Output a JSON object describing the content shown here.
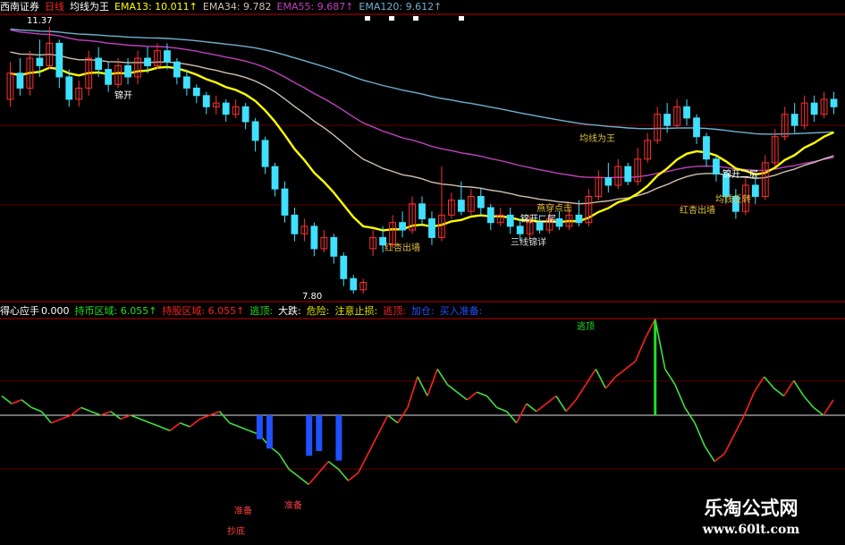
{
  "colors": {
    "background": "#000000",
    "separator": "#c00000",
    "up": "#ff3030",
    "down": "#40e0ff",
    "ema13": "#ffff00",
    "ema34": "#d0c0b0",
    "ema55": "#c040c0",
    "ema120": "#70b0d0",
    "osc_up": "#ff2020",
    "osc_down": "#40e040",
    "bar_blue": "#2050ff",
    "bar_green": "#20e020",
    "zero_line": "#e0e0e0"
  },
  "main_header": {
    "stock": "西南证券",
    "period": "日线",
    "indicator": "均线为王",
    "ema13": "EMA13: 10.011↑",
    "ema34": "EMA34: 9.782",
    "ema55": "EMA55: 9.687↑",
    "ema120": "EMA120: 9.612↑"
  },
  "main_annotations": {
    "high_price": "11.37",
    "low_price": "7.80",
    "labels": [
      "锦开",
      "红杏出墙",
      "三线锦详",
      "锦开二层",
      "锦开二层",
      "燕穿点击",
      "均线为王",
      "红杏出墙",
      "均线反转",
      "锦开二层"
    ]
  },
  "sub_header": {
    "name": "得心应手",
    "value": "0.000",
    "items": [
      {
        "text": "持币区域: 6.055↑",
        "color": "#20e020"
      },
      {
        "text": "持股区域: 6.055↑",
        "color": "#ff2020"
      },
      {
        "text": "逃顶:",
        "color": "#20e020"
      },
      {
        "text": "大跌:",
        "color": "#ffffff"
      },
      {
        "text": "危险:",
        "color": "#e0e000"
      },
      {
        "text": "注意止损:",
        "color": "#e0e000"
      },
      {
        "text": "逃顶:",
        "color": "#ff2020"
      },
      {
        "text": "加仓:",
        "color": "#2050ff"
      },
      {
        "text": "买入准备:",
        "color": "#2050ff"
      }
    ]
  },
  "sub_annotations": {
    "top_label": "逃顶",
    "bottom_labels": [
      "抄底",
      "准备",
      "准备"
    ]
  },
  "watermark": {
    "line1": "乐淘公式网",
    "line2": "www.60lt.com"
  },
  "chart_data": {
    "type": "line",
    "price_range": [
      7.8,
      11.37
    ],
    "candles": [
      [
        10.4,
        10.75,
        10.9,
        10.3
      ],
      [
        10.75,
        10.55,
        10.95,
        10.45
      ],
      [
        10.55,
        10.95,
        11.05,
        10.45
      ],
      [
        10.95,
        10.85,
        11.2,
        10.7
      ],
      [
        10.85,
        11.15,
        11.37,
        10.8
      ],
      [
        11.15,
        10.7,
        11.2,
        10.55
      ],
      [
        10.7,
        10.4,
        10.8,
        10.3
      ],
      [
        10.4,
        10.55,
        10.65,
        10.3
      ],
      [
        10.55,
        10.95,
        11.05,
        10.45
      ],
      [
        10.95,
        10.8,
        11.1,
        10.7
      ],
      [
        10.8,
        10.6,
        10.9,
        10.5
      ],
      [
        10.6,
        10.85,
        10.95,
        10.55
      ],
      [
        10.85,
        10.7,
        10.95,
        10.6
      ],
      [
        10.7,
        10.95,
        11.05,
        10.6
      ],
      [
        10.95,
        10.85,
        11.1,
        10.75
      ],
      [
        10.85,
        11.05,
        11.15,
        10.8
      ],
      [
        11.05,
        10.9,
        11.15,
        10.8
      ],
      [
        10.9,
        10.7,
        10.95,
        10.6
      ],
      [
        10.7,
        10.55,
        10.8,
        10.45
      ],
      [
        10.55,
        10.45,
        10.6,
        10.35
      ],
      [
        10.45,
        10.3,
        10.5,
        10.2
      ],
      [
        10.3,
        10.35,
        10.45,
        10.2
      ],
      [
        10.35,
        10.2,
        10.4,
        10.1
      ],
      [
        10.2,
        10.3,
        10.4,
        10.15
      ],
      [
        10.3,
        10.1,
        10.35,
        10.0
      ],
      [
        10.1,
        9.85,
        10.15,
        9.7
      ],
      [
        9.85,
        9.5,
        9.9,
        9.4
      ],
      [
        9.5,
        9.2,
        9.55,
        9.1
      ],
      [
        9.2,
        8.85,
        9.3,
        8.75
      ],
      [
        8.85,
        8.6,
        8.95,
        8.5
      ],
      [
        8.6,
        8.7,
        8.8,
        8.5
      ],
      [
        8.7,
        8.4,
        8.75,
        8.3
      ],
      [
        8.4,
        8.55,
        8.65,
        8.35
      ],
      [
        8.55,
        8.3,
        8.6,
        8.2
      ],
      [
        8.3,
        8.0,
        8.35,
        7.9
      ],
      [
        8.0,
        7.85,
        8.05,
        7.8
      ],
      [
        7.85,
        7.95,
        8.0,
        7.8
      ],
      [
        8.4,
        8.55,
        8.65,
        8.3
      ],
      [
        8.55,
        8.45,
        8.7,
        8.35
      ],
      [
        8.45,
        8.75,
        8.85,
        8.4
      ],
      [
        8.75,
        8.65,
        8.9,
        8.55
      ],
      [
        8.65,
        9.0,
        9.1,
        8.6
      ],
      [
        9.0,
        8.8,
        9.1,
        8.7
      ],
      [
        8.8,
        8.55,
        8.9,
        8.45
      ],
      [
        8.55,
        8.85,
        9.5,
        8.5
      ],
      [
        8.85,
        9.05,
        9.15,
        8.8
      ],
      [
        9.05,
        8.9,
        9.3,
        8.85
      ],
      [
        8.9,
        9.1,
        9.2,
        8.85
      ],
      [
        9.1,
        8.95,
        9.2,
        8.85
      ],
      [
        8.95,
        8.75,
        9.0,
        8.65
      ],
      [
        8.75,
        8.85,
        8.95,
        8.7
      ],
      [
        8.85,
        8.7,
        8.95,
        8.6
      ],
      [
        8.7,
        8.6,
        8.8,
        8.5
      ],
      [
        8.6,
        8.75,
        8.85,
        8.55
      ],
      [
        8.75,
        8.65,
        8.85,
        8.6
      ],
      [
        8.65,
        8.8,
        8.9,
        8.6
      ],
      [
        8.8,
        8.7,
        8.9,
        8.65
      ],
      [
        8.7,
        8.85,
        8.95,
        8.65
      ],
      [
        8.85,
        8.75,
        9.05,
        8.7
      ],
      [
        8.75,
        9.1,
        9.2,
        8.7
      ],
      [
        9.1,
        9.35,
        9.45,
        9.05
      ],
      [
        9.35,
        9.25,
        9.55,
        9.15
      ],
      [
        9.25,
        9.5,
        9.6,
        9.2
      ],
      [
        9.5,
        9.3,
        9.55,
        9.25
      ],
      [
        9.3,
        9.6,
        9.75,
        9.25
      ],
      [
        9.6,
        9.85,
        9.95,
        9.55
      ],
      [
        9.85,
        10.2,
        10.3,
        9.8
      ],
      [
        10.2,
        10.05,
        10.35,
        9.95
      ],
      [
        10.05,
        10.3,
        10.4,
        10.0
      ],
      [
        10.3,
        10.15,
        10.4,
        10.05
      ],
      [
        10.15,
        9.9,
        10.2,
        9.8
      ],
      [
        9.9,
        9.6,
        9.95,
        9.5
      ],
      [
        9.6,
        9.4,
        9.65,
        9.3
      ],
      [
        9.4,
        9.1,
        9.45,
        9.0
      ],
      [
        9.1,
        8.9,
        9.2,
        8.8
      ],
      [
        8.9,
        9.25,
        9.35,
        8.85
      ],
      [
        9.25,
        9.1,
        9.35,
        9.0
      ],
      [
        9.1,
        9.55,
        9.65,
        9.05
      ],
      [
        9.55,
        9.9,
        10.0,
        9.5
      ],
      [
        9.9,
        10.2,
        10.3,
        9.85
      ],
      [
        10.2,
        10.05,
        10.35,
        9.95
      ],
      [
        10.05,
        10.35,
        10.45,
        10.0
      ],
      [
        10.35,
        10.2,
        10.45,
        10.1
      ],
      [
        10.2,
        10.4,
        10.5,
        10.15
      ],
      [
        10.4,
        10.3,
        10.5,
        10.2
      ]
    ],
    "oscillator": [
      0.05,
      0.03,
      0.04,
      0.02,
      0.01,
      -0.02,
      -0.01,
      0.0,
      0.02,
      0.01,
      0.0,
      0.01,
      -0.01,
      0.0,
      -0.01,
      -0.02,
      -0.03,
      -0.04,
      -0.02,
      -0.03,
      -0.01,
      0.0,
      0.01,
      -0.02,
      -0.03,
      -0.04,
      -0.05,
      -0.08,
      -0.1,
      -0.14,
      -0.16,
      -0.18,
      -0.15,
      -0.12,
      -0.14,
      -0.17,
      -0.15,
      -0.1,
      -0.05,
      0.0,
      -0.02,
      0.02,
      0.1,
      0.05,
      0.12,
      0.08,
      0.06,
      0.04,
      0.06,
      0.05,
      0.02,
      0.01,
      -0.02,
      0.03,
      0.01,
      0.03,
      0.05,
      0.01,
      0.04,
      0.08,
      0.12,
      0.07,
      0.1,
      0.12,
      0.14,
      0.2,
      0.25,
      0.12,
      0.08,
      0.02,
      -0.02,
      -0.08,
      -0.12,
      -0.1,
      -0.05,
      0.0,
      0.06,
      0.1,
      0.07,
      0.05,
      0.09,
      0.05,
      0.02,
      0.0,
      0.04
    ]
  }
}
